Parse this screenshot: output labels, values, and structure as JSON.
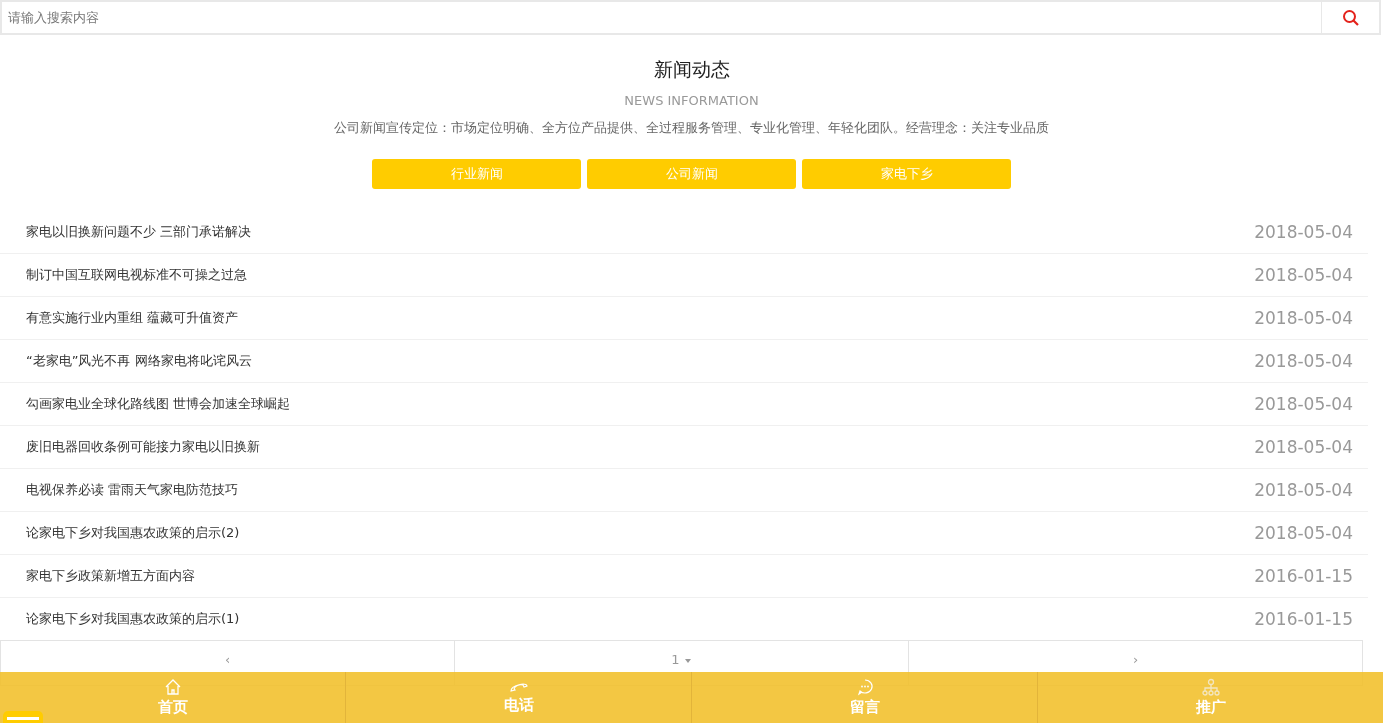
{
  "search": {
    "placeholder": "请输入搜索内容"
  },
  "header": {
    "title": "新闻动态",
    "subtitle": "NEWS INFORMATION",
    "description": "公司新闻宣传定位：市场定位明确、全方位产品提供、全过程服务管理、专业化管理、年轻化团队。经营理念：关注专业品质"
  },
  "categories": [
    "行业新闻",
    "公司新闻",
    "家电下乡"
  ],
  "news": [
    {
      "title": "家电以旧换新问题不少 三部门承诺解决",
      "date": "2018-05-04"
    },
    {
      "title": "制订中国互联网电视标准不可操之过急",
      "date": "2018-05-04"
    },
    {
      "title": "有意实施行业内重组 蕴藏可升值资产",
      "date": "2018-05-04"
    },
    {
      "title": "“老家电”风光不再 网络家电将叱诧风云",
      "date": "2018-05-04"
    },
    {
      "title": "勾画家电业全球化路线图 世博会加速全球崛起",
      "date": "2018-05-04"
    },
    {
      "title": "废旧电器回收条例可能接力家电以旧换新",
      "date": "2018-05-04"
    },
    {
      "title": "电视保养必读 雷雨天气家电防范技巧",
      "date": "2018-05-04"
    },
    {
      "title": "论家电下乡对我国惠农政策的启示(2)",
      "date": "2018-05-04"
    },
    {
      "title": "家电下乡政策新增五方面内容",
      "date": "2016-01-15"
    },
    {
      "title": "论家电下乡对我国惠农政策的启示(1)",
      "date": "2016-01-15"
    }
  ],
  "pagination": {
    "prev": "‹",
    "page": "1",
    "next": "›"
  },
  "bottom_nav": [
    {
      "kind": "home",
      "label": "首页"
    },
    {
      "kind": "phone",
      "label": "电话"
    },
    {
      "kind": "message",
      "label": "留言"
    },
    {
      "kind": "share",
      "label": "推广"
    }
  ]
}
